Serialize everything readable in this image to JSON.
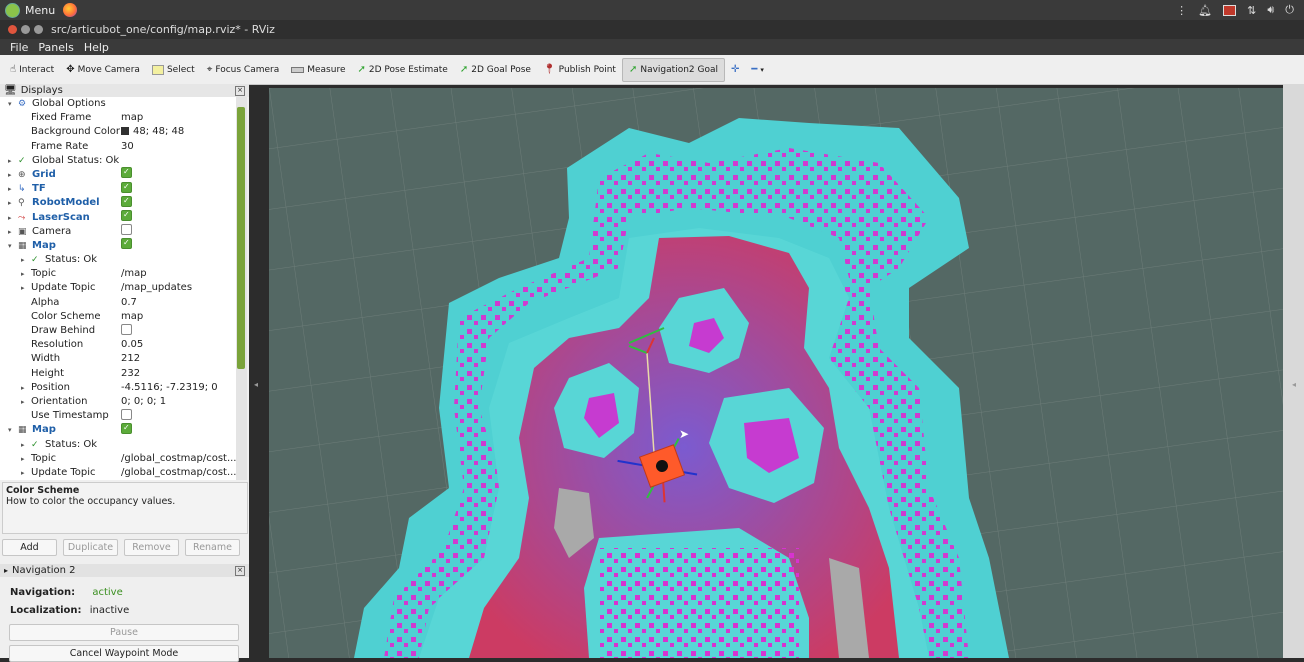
{
  "taskbar": {
    "menu_label": "Menu"
  },
  "window": {
    "title": "src/articubot_one/config/map.rviz* - RViz"
  },
  "menubar": {
    "file": "File",
    "panels": "Panels",
    "help": "Help"
  },
  "toolbar": {
    "interact": "Interact",
    "move_camera": "Move Camera",
    "select": "Select",
    "focus_camera": "Focus Camera",
    "measure": "Measure",
    "pose_estimate": "2D Pose Estimate",
    "goal_pose": "2D Goal Pose",
    "publish_point": "Publish Point",
    "nav2_goal": "Navigation2 Goal"
  },
  "displays": {
    "title": "Displays",
    "rows": [
      {
        "label": "Global Options",
        "value": ""
      },
      {
        "label": "Fixed Frame",
        "value": "map"
      },
      {
        "label": "Background Color",
        "value": "48; 48; 48"
      },
      {
        "label": "Frame Rate",
        "value": "30"
      },
      {
        "label": "Global Status: Ok",
        "value": ""
      },
      {
        "label": "Grid",
        "value": ""
      },
      {
        "label": "TF",
        "value": ""
      },
      {
        "label": "RobotModel",
        "value": ""
      },
      {
        "label": "LaserScan",
        "value": ""
      },
      {
        "label": "Camera",
        "value": ""
      },
      {
        "label": "Map",
        "value": ""
      },
      {
        "label": "Status: Ok",
        "value": ""
      },
      {
        "label": "Topic",
        "value": "/map"
      },
      {
        "label": "Update Topic",
        "value": "/map_updates"
      },
      {
        "label": "Alpha",
        "value": "0.7"
      },
      {
        "label": "Color Scheme",
        "value": "map"
      },
      {
        "label": "Draw Behind",
        "value": ""
      },
      {
        "label": "Resolution",
        "value": "0.05"
      },
      {
        "label": "Width",
        "value": "212"
      },
      {
        "label": "Height",
        "value": "232"
      },
      {
        "label": "Position",
        "value": "-4.5116; -7.2319; 0"
      },
      {
        "label": "Orientation",
        "value": "0; 0; 0; 1"
      },
      {
        "label": "Use Timestamp",
        "value": ""
      },
      {
        "label": "Map",
        "value": ""
      },
      {
        "label": "Status: Ok",
        "value": ""
      },
      {
        "label": "Topic",
        "value": "/global_costmap/cost..."
      },
      {
        "label": "Update Topic",
        "value": "/global_costmap/cost..."
      }
    ]
  },
  "description": {
    "title": "Color Scheme",
    "text": "How to color the occupancy values."
  },
  "buttons": {
    "add": "Add",
    "duplicate": "Duplicate",
    "remove": "Remove",
    "rename": "Rename"
  },
  "nav2": {
    "title": "Navigation 2",
    "navigation_label": "Navigation:",
    "navigation_value": "active",
    "localization_label": "Localization:",
    "localization_value": "inactive",
    "pause": "Pause",
    "cancel": "Cancel Waypoint Mode"
  },
  "colors": {
    "background": "#303030",
    "accent": "#5cab3a",
    "active_status": "#3a8f1f"
  }
}
